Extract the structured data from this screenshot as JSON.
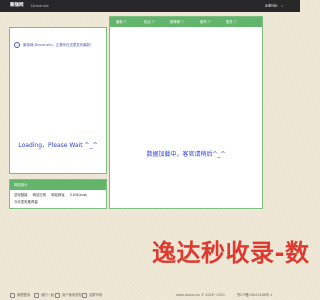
{
  "header": {
    "logo": "聚咖网",
    "subtitle": "Dzmanzle",
    "user": "admin",
    "user_arrow": "▽"
  },
  "notice": {
    "icon": "i",
    "text": "聚咖网(Dzmanzle)，正要你在这里发布最新！"
  },
  "left_panel": {
    "loading": "Loading，Please Wait ^_^"
  },
  "stats_panel": {
    "title": "网站统计",
    "items": [
      "总收链接",
      "网站已收",
      "网站网址",
      "5108(sub)",
      "今天发布推荐量"
    ]
  },
  "tabs": [
    "最新 ▽",
    "热点 ▽",
    "推荐榜 ▽",
    "都市 ▽",
    "更多 ▽"
  ],
  "main": {
    "empty": "数据加载中，客官请稍后^_^"
  },
  "watermark": "逸达秒收录-数",
  "footer": {
    "items": [
      "管理登录",
      "我们一起",
      "用户使用须知",
      "站群市场"
    ],
    "copyright": "www.duola.xin © 2018~2021",
    "icp": "鲁ICP备19041406号-1"
  }
}
